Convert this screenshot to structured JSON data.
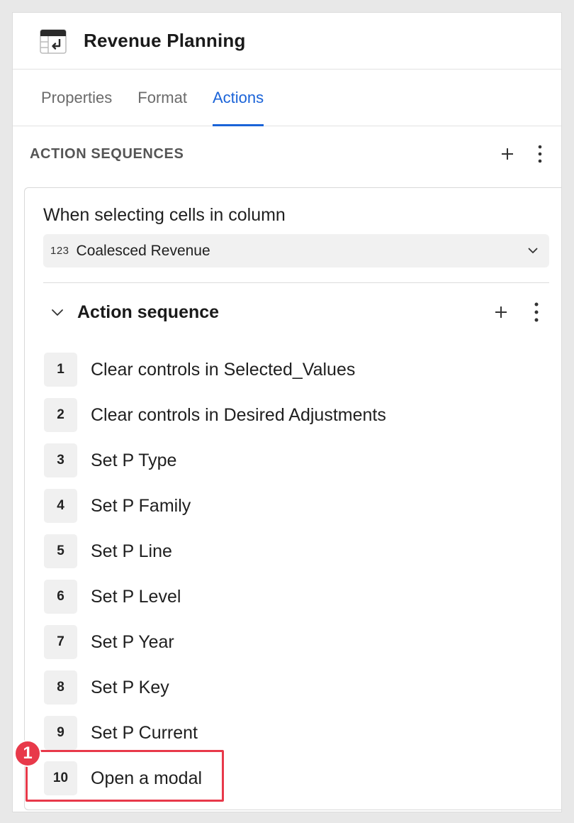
{
  "header": {
    "title": "Revenue Planning",
    "icon": "table-action-icon"
  },
  "tabs": [
    {
      "label": "Properties",
      "active": false
    },
    {
      "label": "Format",
      "active": false
    },
    {
      "label": "Actions",
      "active": true
    }
  ],
  "section": {
    "label": "ACTION SEQUENCES",
    "add_icon": "plus-icon",
    "more_icon": "more-vertical-icon"
  },
  "trigger": {
    "text": "When selecting cells in column",
    "column_type": "123",
    "column_value": "Coalesced Revenue"
  },
  "sequence": {
    "title": "Action sequence",
    "expanded": true,
    "steps": [
      {
        "num": "1",
        "text": "Clear controls in Selected_Values"
      },
      {
        "num": "2",
        "text": "Clear controls in Desired Adjustments"
      },
      {
        "num": "3",
        "text": "Set P Type"
      },
      {
        "num": "4",
        "text": "Set P Family"
      },
      {
        "num": "5",
        "text": "Set P Line"
      },
      {
        "num": "6",
        "text": "Set P Level"
      },
      {
        "num": "7",
        "text": "Set P Year"
      },
      {
        "num": "8",
        "text": "Set P Key"
      },
      {
        "num": "9",
        "text": "Set P Current"
      },
      {
        "num": "10",
        "text": "Open a modal"
      }
    ]
  },
  "annotation": {
    "callout_number": "1",
    "color": "#e8394a"
  },
  "colors": {
    "accent": "#1a63d8"
  }
}
